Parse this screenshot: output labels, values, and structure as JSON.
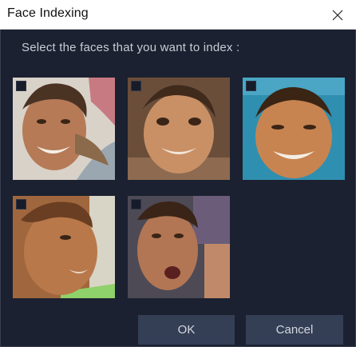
{
  "dialog": {
    "title": "Face Indexing",
    "close_icon": "close-icon"
  },
  "prompt": "Select the faces that you want to index :",
  "faces": [
    {
      "checked": false,
      "icon": "face-thumbnail"
    },
    {
      "checked": false,
      "icon": "face-thumbnail"
    },
    {
      "checked": false,
      "icon": "face-thumbnail"
    },
    {
      "checked": false,
      "icon": "face-thumbnail"
    },
    {
      "checked": false,
      "icon": "face-thumbnail"
    }
  ],
  "buttons": {
    "ok_label": "OK",
    "cancel_label": "Cancel"
  },
  "colors": {
    "background": "#1b2130",
    "button": "#343e55",
    "title_bar": "#ffffff"
  }
}
